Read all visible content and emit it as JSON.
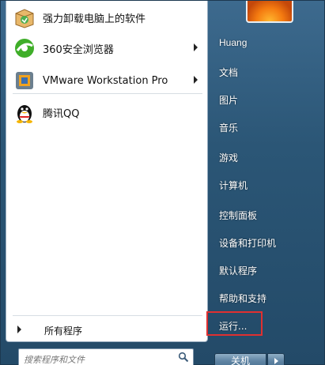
{
  "programs": [
    {
      "label": "强力卸载电脑上的软件",
      "icon": "uninstall-box-icon",
      "has_submenu": false
    },
    {
      "label": "360安全浏览器",
      "icon": "browser-360-icon",
      "has_submenu": true
    },
    {
      "label": "VMware Workstation Pro",
      "icon": "vmware-icon",
      "has_submenu": true
    },
    {
      "label": "腾讯QQ",
      "icon": "qq-penguin-icon",
      "has_submenu": false
    }
  ],
  "all_programs": "所有程序",
  "search": {
    "placeholder": "搜索程序和文件"
  },
  "right": {
    "user": "Huang",
    "items": [
      "文档",
      "图片",
      "音乐",
      "游戏",
      "计算机",
      "控制面板",
      "设备和打印机",
      "默认程序",
      "帮助和支持",
      "运行..."
    ]
  },
  "shutdown": {
    "label": "关机"
  },
  "colors": {
    "highlight": "#e03030",
    "menu_bg": "#2b5676"
  }
}
